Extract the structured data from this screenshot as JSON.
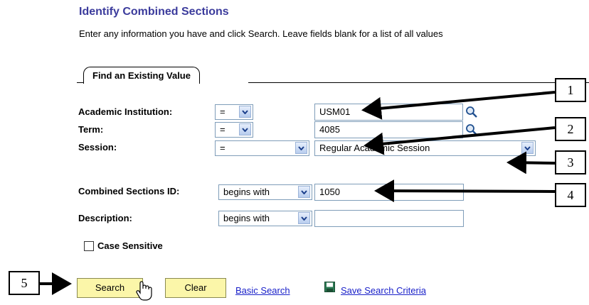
{
  "header": {
    "title": "Identify Combined Sections",
    "instructions": "Enter any information you have and click Search. Leave fields blank for a list of all values"
  },
  "tab": {
    "label": "Find an Existing Value"
  },
  "fields": [
    {
      "label": "Academic Institution:",
      "operator": "=",
      "value": "USM01",
      "lookup": true
    },
    {
      "label": "Term:",
      "operator": "=",
      "value": "4085",
      "lookup": true
    },
    {
      "label": "Session:",
      "operator": "=",
      "value": "Regular Academic Session",
      "lookup": false
    },
    {
      "label": "Combined Sections ID:",
      "operator": "begins with",
      "value": "1050",
      "lookup": false
    },
    {
      "label": "Description:",
      "operator": "begins with",
      "value": "",
      "lookup": false
    }
  ],
  "case_sensitive": {
    "label": "Case Sensitive",
    "checked": false
  },
  "buttons": {
    "search": "Search",
    "clear": "Clear"
  },
  "links": {
    "basic_search": "Basic Search",
    "save_criteria": "Save Search Criteria"
  },
  "callouts": [
    "1",
    "2",
    "3",
    "4",
    "5"
  ]
}
